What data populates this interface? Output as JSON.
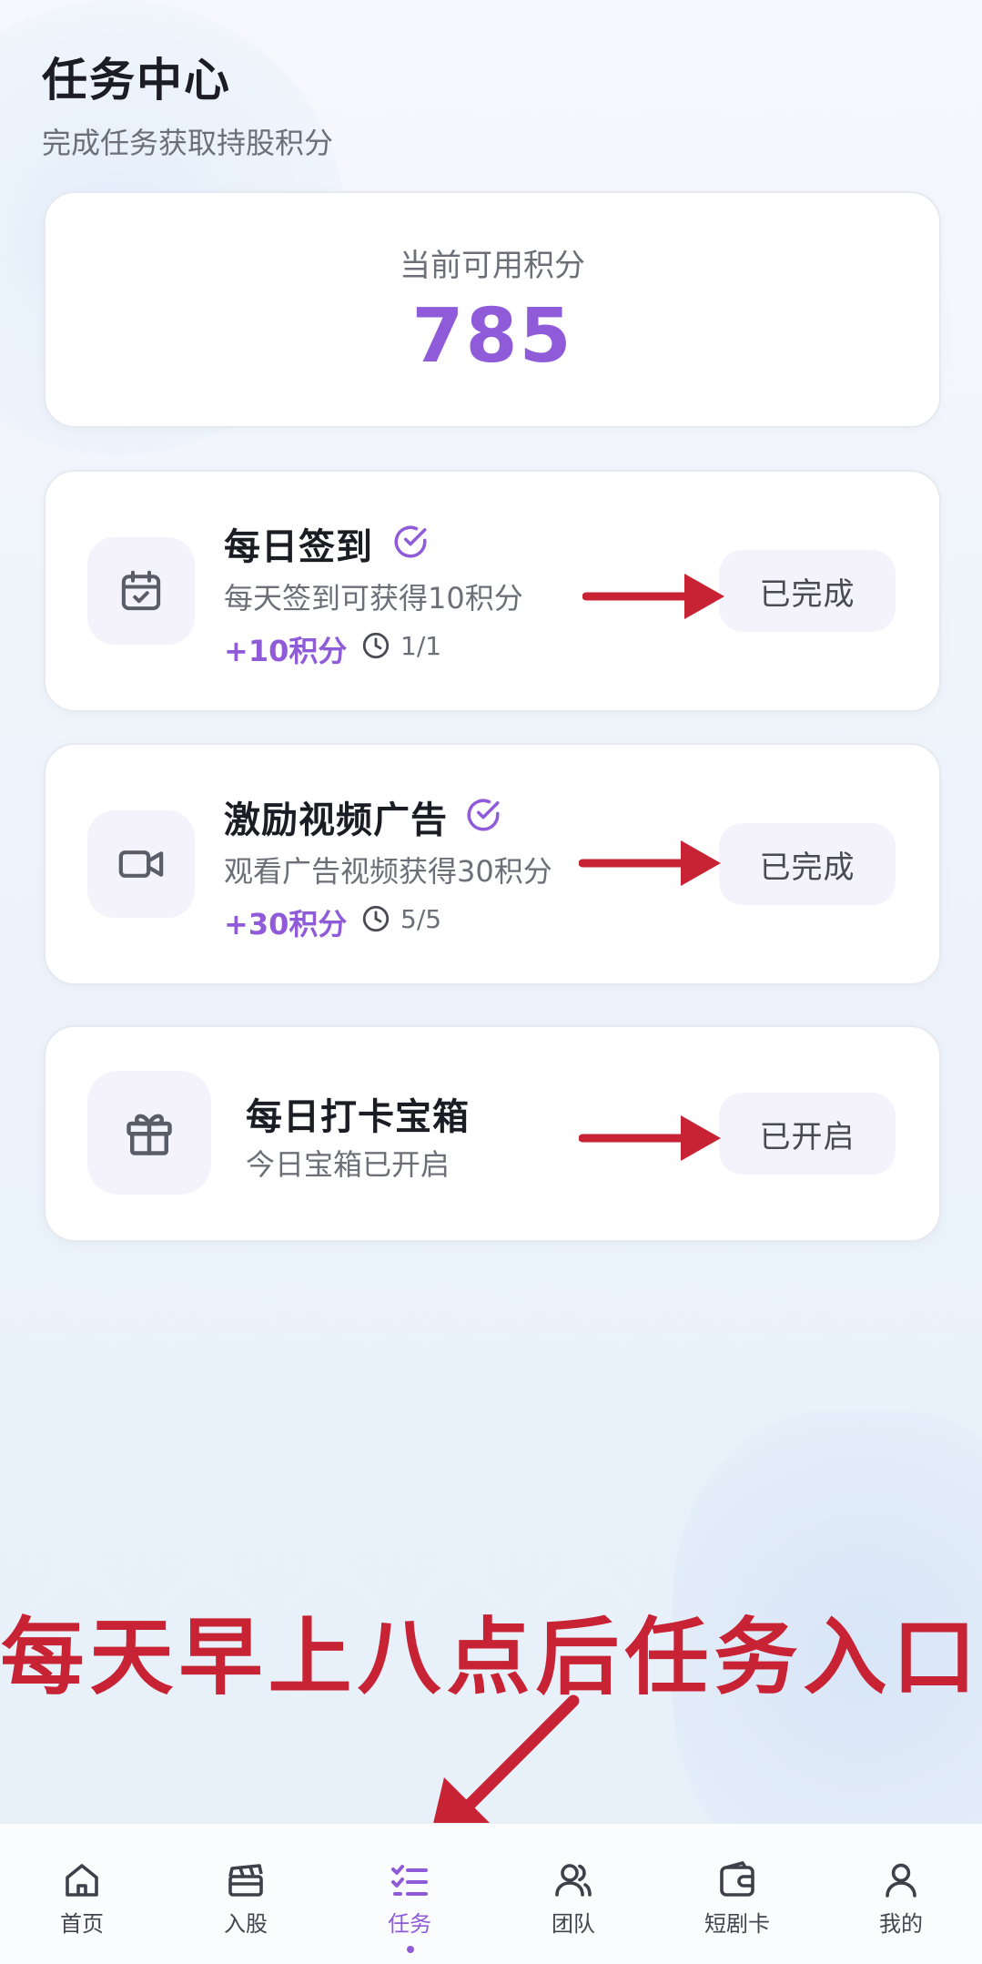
{
  "header": {
    "title": "任务中心",
    "subtitle": "完成任务获取持股积分"
  },
  "points": {
    "label": "当前可用积分",
    "value": "785"
  },
  "tasks": [
    {
      "icon": "calendar-check-icon",
      "title": "每日签到",
      "completed_check": true,
      "description": "每天签到可获得10积分",
      "reward": "+10积分",
      "progress": "1/1",
      "status_label": "已完成"
    },
    {
      "icon": "video-camera-icon",
      "title": "激励视频广告",
      "completed_check": true,
      "description": "观看广告视频获得30积分",
      "reward": "+30积分",
      "progress": "5/5",
      "status_label": "已完成"
    },
    {
      "icon": "gift-icon",
      "title": "每日打卡宝箱",
      "description": "今日宝箱已开启",
      "status_label": "已开启"
    }
  ],
  "annotation": {
    "text": "每天早上八点后任务入口",
    "color": "#c82334"
  },
  "tabbar": {
    "active": "任务",
    "items": [
      {
        "label": "首页",
        "icon": "home-icon"
      },
      {
        "label": "入股",
        "icon": "clapperboard-icon"
      },
      {
        "label": "任务",
        "icon": "task-list-icon"
      },
      {
        "label": "团队",
        "icon": "team-icon"
      },
      {
        "label": "短剧卡",
        "icon": "wallet-card-icon"
      },
      {
        "label": "我的",
        "icon": "user-icon"
      }
    ]
  },
  "colors": {
    "accent": "#8f5bd9",
    "annotation_red": "#c82334"
  }
}
